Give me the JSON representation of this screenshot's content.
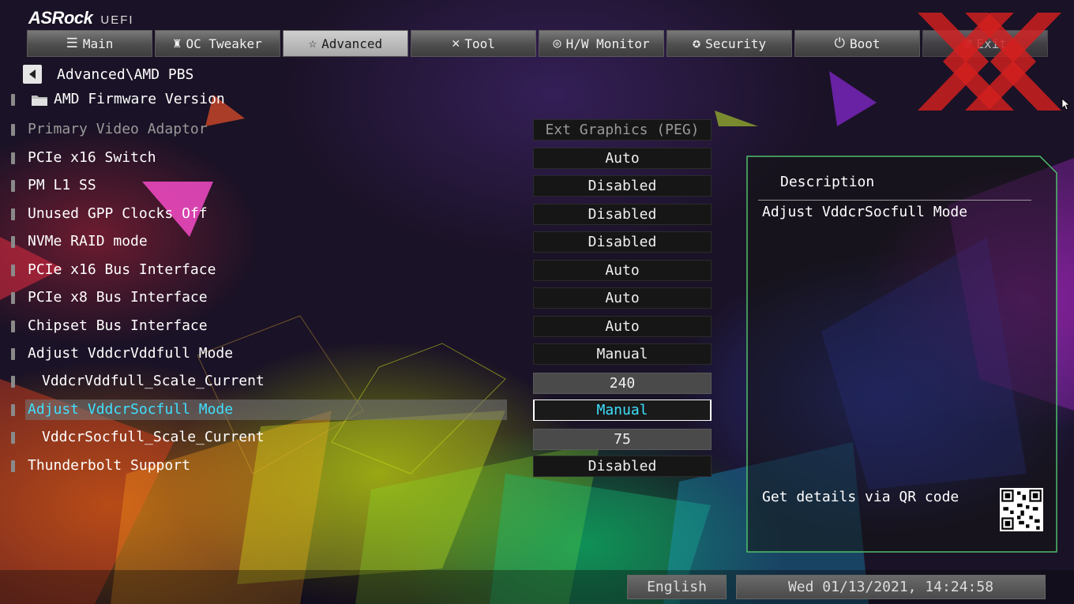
{
  "header": {
    "brand": "ASRock",
    "subtitle": "UEFI"
  },
  "tabs": [
    {
      "label": "Main",
      "icon": "list-icon"
    },
    {
      "label": "OC Tweaker",
      "icon": "rocket-icon"
    },
    {
      "label": "Advanced",
      "icon": "star-icon"
    },
    {
      "label": "Tool",
      "icon": "wrench-icon"
    },
    {
      "label": "H/W Monitor",
      "icon": "monitor-icon"
    },
    {
      "label": "Security",
      "icon": "shield-icon"
    },
    {
      "label": "Boot",
      "icon": "power-icon"
    },
    {
      "label": "Exit",
      "icon": "exit-icon"
    }
  ],
  "active_tab": "Advanced",
  "breadcrumb": "Advanced\\AMD PBS",
  "settings": [
    {
      "label": "AMD Firmware Version"
    },
    {
      "label": "Primary Video Adaptor",
      "value": "Ext Graphics (PEG)"
    },
    {
      "label": "PCIe x16 Switch",
      "value": "Auto"
    },
    {
      "label": "PM L1 SS",
      "value": "Disabled"
    },
    {
      "label": "Unused GPP Clocks Off",
      "value": "Disabled"
    },
    {
      "label": "NVMe RAID mode",
      "value": "Disabled"
    },
    {
      "label": "PCIe x16 Bus Interface",
      "value": "Auto"
    },
    {
      "label": "PCIe x8 Bus Interface",
      "value": "Auto"
    },
    {
      "label": "Chipset Bus Interface",
      "value": "Auto"
    },
    {
      "label": "Adjust VddcrVddfull Mode",
      "value": "Manual"
    },
    {
      "label": "VddcrVddfull_Scale_Current",
      "value": "240"
    },
    {
      "label": "Adjust VddcrSocfull Mode",
      "value": "Manual"
    },
    {
      "label": "VddcrSocfull_Scale_Current",
      "value": "75"
    },
    {
      "label": "Thunderbolt Support",
      "value": "Disabled"
    }
  ],
  "selected_setting": "Adjust VddcrSocfull Mode",
  "description": {
    "title": "Description",
    "text": "Adjust VddcrSocfull Mode",
    "qr_hint": "Get details via QR code"
  },
  "footer": {
    "language": "English",
    "datetime": "Wed 01/13/2021, 14:24:58"
  },
  "colors": {
    "highlight_text": "#3fe0ff",
    "panel_border": "#4fbf6a",
    "watermark": "#d42020"
  }
}
